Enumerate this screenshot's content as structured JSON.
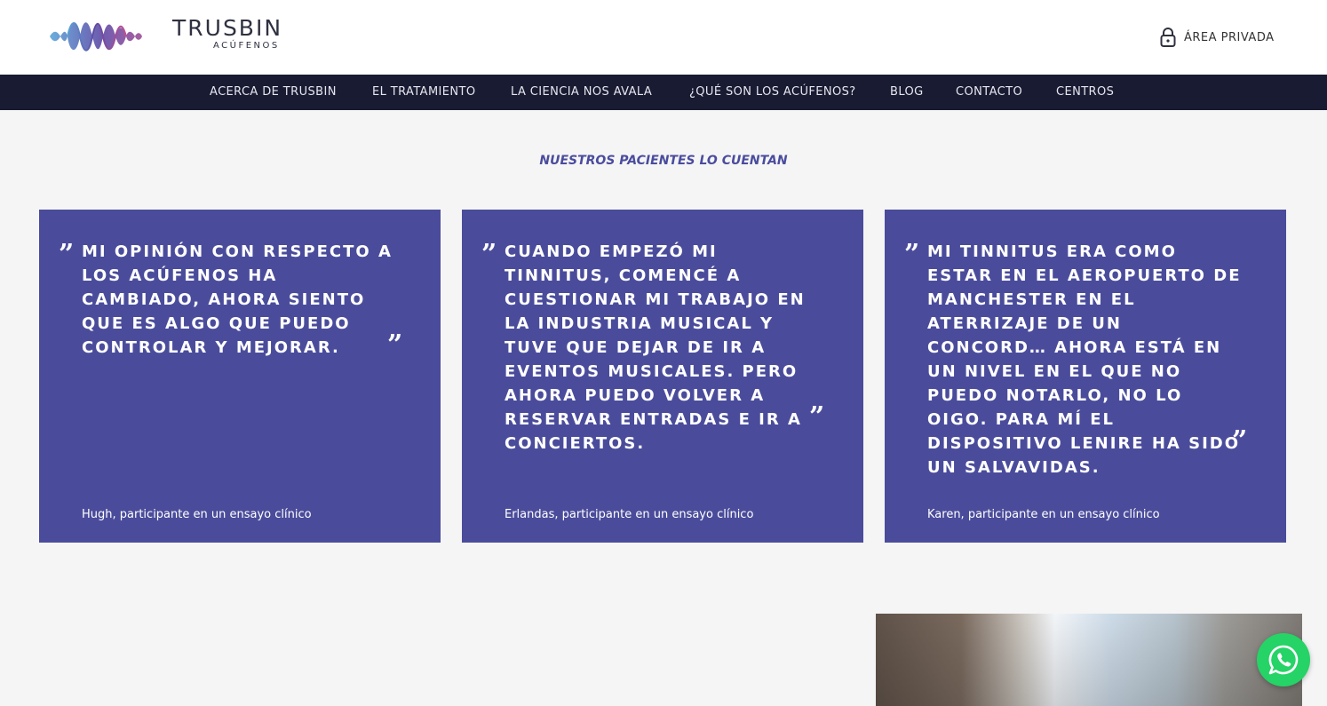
{
  "brand": {
    "name": "TRUSBIN",
    "tagline": "ACÚFENOS"
  },
  "header": {
    "private_area_label": "ÁREA PRIVADA"
  },
  "nav": {
    "items": [
      {
        "label": "ACERCA DE TRUSBIN"
      },
      {
        "label": "EL TRATAMIENTO"
      },
      {
        "label": "LA CIENCIA NOS AVALA"
      },
      {
        "label": "¿QUÉ SON LOS ACÚFENOS?"
      },
      {
        "label": "BLOG"
      },
      {
        "label": "CONTACTO"
      },
      {
        "label": "CENTROS"
      }
    ]
  },
  "testimonials": {
    "title": "NUESTROS PACIENTES LO CUENTAN",
    "items": [
      {
        "quote": "MI OPINIÓN CON RESPECTO A LOS ACÚFENOS HA CAMBIADO, AHORA SIENTO QUE ES ALGO QUE PUEDO CONTROLAR Y MEJORAR.",
        "author": "Hugh, participante en un ensayo clínico"
      },
      {
        "quote": "CUANDO EMPEZÓ MI TINNITUS, COMENCÉ A CUESTIONAR MI TRABAJO EN LA INDUSTRIA MUSICAL Y TUVE QUE DEJAR DE IR A EVENTOS MUSICALES. PERO AHORA PUEDO VOLVER A RESERVAR ENTRADAS E IR A CONCIERTOS.",
        "author": "Erlandas, participante en un ensayo clínico"
      },
      {
        "quote": "MI TINNITUS ERA COMO ESTAR EN EL AEROPUERTO DE MANCHESTER EN EL ATERRIZAJE DE UN CONCORD… AHORA ESTÁ EN UN NIVEL EN EL QUE NO PUEDO NOTARLO, NO LO OIGO. PARA MÍ EL DISPOSITIVO LENIRE HA SIDO UN SALVAVIDAS.",
        "author": "Karen, participante en un ensayo clínico"
      }
    ]
  },
  "quote_marks": {
    "open": "”",
    "close": "”"
  },
  "colors": {
    "nav_bg": "#191b33",
    "card_bg": "#4a4c9b",
    "title_color": "#4a4c9e",
    "whatsapp": "#25d366",
    "logo_gradient": [
      "#5aa5d8",
      "#5d4aa6",
      "#c0508f"
    ]
  },
  "icons": {
    "logo": "sound-wave-logo",
    "private_area": "lock-icon",
    "whatsapp": "whatsapp-icon",
    "quote": "quote-mark-icon"
  }
}
